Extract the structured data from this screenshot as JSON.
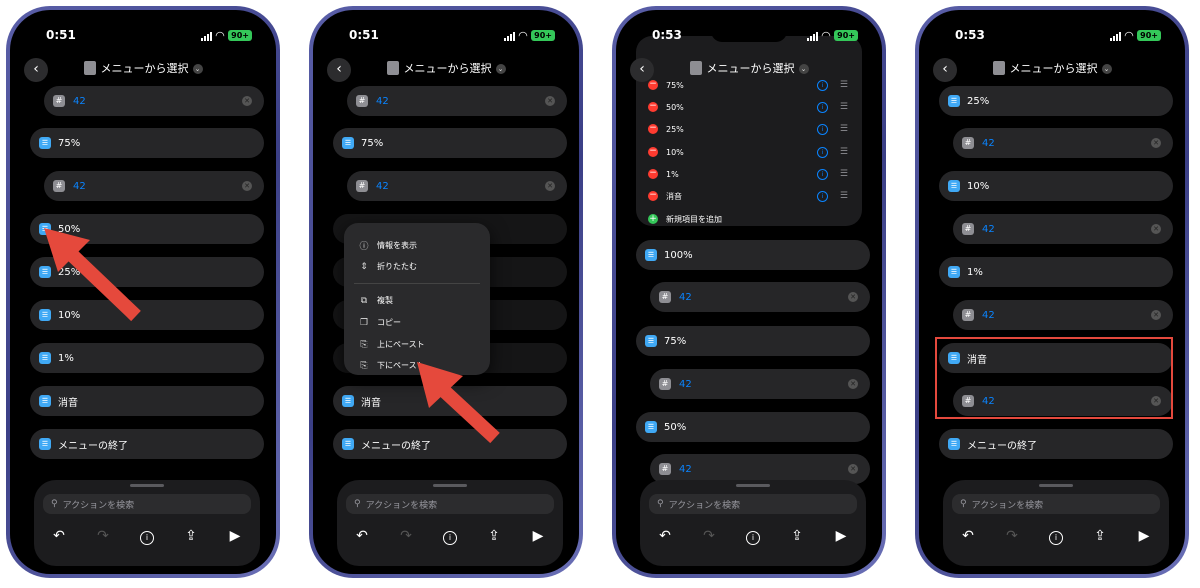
{
  "status": {
    "time_1": "0:51",
    "time_2": "0:51",
    "time_3": "0:53",
    "time_4": "0:53",
    "battery": "90+"
  },
  "nav": {
    "title": "メニューから選択"
  },
  "rows": {
    "num": "42",
    "p100": "100%",
    "p75": "75%",
    "p50": "50%",
    "p25": "25%",
    "p10": "10%",
    "p1": "1%",
    "mute": "消音",
    "end": "メニューの終了"
  },
  "menu": {
    "show_info": "情報を表示",
    "collapse": "折りたたむ",
    "duplicate": "複製",
    "copy": "コピー",
    "paste_above": "上にペースト",
    "paste_below": "下にペースト"
  },
  "list": {
    "items": [
      "75%",
      "50%",
      "25%",
      "10%",
      "1%",
      "消音"
    ],
    "add_new": "新規項目を追加"
  },
  "panel": {
    "search_placeholder": "アクションを検索"
  },
  "colors": {
    "accent": "#0a84ff",
    "highlight": "#e4493d",
    "arrow": "#e5493c",
    "folder": "#40a9f5"
  }
}
